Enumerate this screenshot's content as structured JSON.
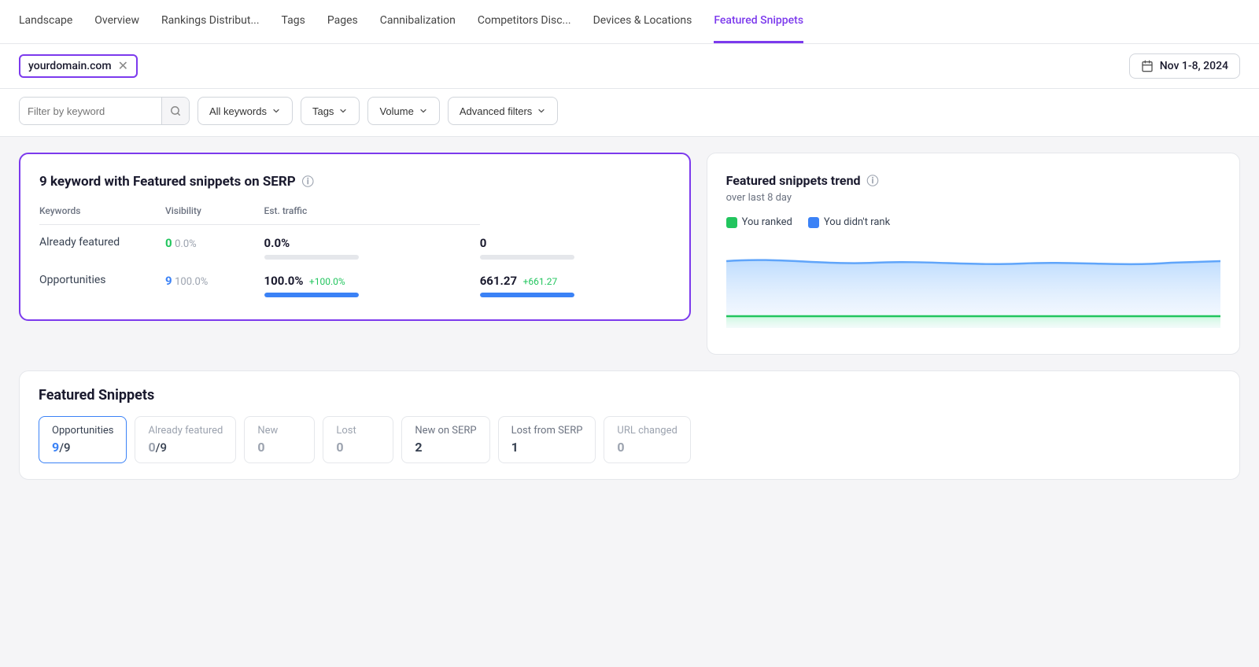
{
  "nav": {
    "items": [
      {
        "label": "Landscape",
        "active": false
      },
      {
        "label": "Overview",
        "active": false
      },
      {
        "label": "Rankings Distribut...",
        "active": false
      },
      {
        "label": "Tags",
        "active": false
      },
      {
        "label": "Pages",
        "active": false
      },
      {
        "label": "Cannibalization",
        "active": false
      },
      {
        "label": "Competitors Disc...",
        "active": false
      },
      {
        "label": "Devices & Locations",
        "active": false
      },
      {
        "label": "Featured Snippets",
        "active": true
      }
    ]
  },
  "toolbar": {
    "domain": "yourdomain.com",
    "date_label": "Nov 1-8, 2024"
  },
  "filters": {
    "search_placeholder": "Filter by keyword",
    "all_keywords": "All keywords",
    "tags": "Tags",
    "volume": "Volume",
    "advanced_filters": "Advanced filters"
  },
  "summary_card": {
    "title": "9 keyword with Featured snippets on SERP",
    "columns": {
      "keywords": "Keywords",
      "visibility": "Visibility",
      "est_traffic": "Est. traffic"
    },
    "rows": [
      {
        "label": "Already featured",
        "count": "0",
        "count_color": "green",
        "pct": "0.0%",
        "visibility": "0.0%",
        "visibility_change": "",
        "traffic": "0",
        "traffic_change": "",
        "bar_width_vis": 0,
        "bar_width_traffic": 0,
        "bar_color": "gray"
      },
      {
        "label": "Opportunities",
        "count": "9",
        "count_color": "blue",
        "pct": "100.0%",
        "visibility": "100.0%",
        "visibility_change": "+100.0%",
        "traffic": "661.27",
        "traffic_change": "+661.27",
        "bar_width_vis": 100,
        "bar_width_traffic": 100,
        "bar_color": "blue"
      }
    ]
  },
  "trend_card": {
    "title": "Featured snippets trend",
    "subtitle": "over last 8 day",
    "legend": [
      {
        "label": "You ranked",
        "color": "green"
      },
      {
        "label": "You didn't rank",
        "color": "blue"
      }
    ]
  },
  "featured_snippets": {
    "section_title": "Featured Snippets",
    "tabs": [
      {
        "label": "Opportunities",
        "value": "9",
        "value_suffix": "/9",
        "active": true,
        "style": "normal"
      },
      {
        "label": "Already featured",
        "value": "0",
        "value_suffix": "/9",
        "active": false,
        "style": "gray"
      },
      {
        "label": "New",
        "value": "0",
        "value_suffix": "",
        "active": false,
        "style": "gray"
      },
      {
        "label": "Lost",
        "value": "0",
        "value_suffix": "",
        "active": false,
        "style": "gray"
      },
      {
        "label": "New on SERP",
        "value": "2",
        "value_suffix": "",
        "active": false,
        "style": "normal"
      },
      {
        "label": "Lost from SERP",
        "value": "1",
        "value_suffix": "",
        "active": false,
        "style": "normal"
      },
      {
        "label": "URL changed",
        "value": "0",
        "value_suffix": "",
        "active": false,
        "style": "gray"
      }
    ]
  }
}
